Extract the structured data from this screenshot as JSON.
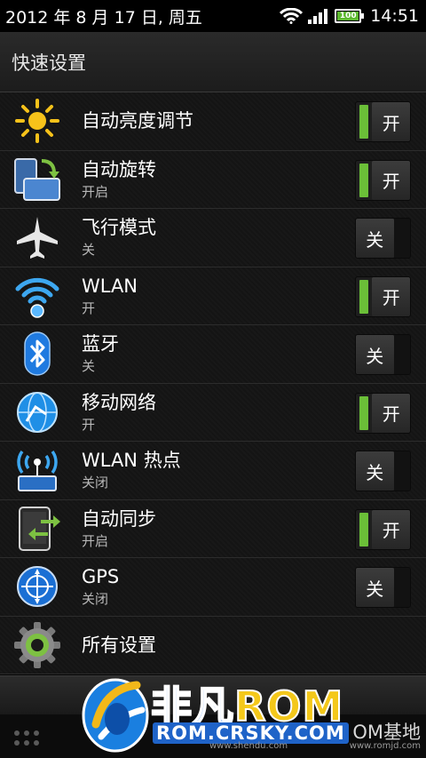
{
  "status_bar": {
    "date": "2012 年 8 月 17 日, 周五",
    "battery": "100",
    "time": "14:51"
  },
  "header": {
    "title": "快速设置"
  },
  "items": [
    {
      "icon": "brightness-icon",
      "label": "自动亮度调节",
      "sub": "",
      "toggle": "开",
      "state": "on"
    },
    {
      "icon": "rotate-icon",
      "label": "自动旋转",
      "sub": "开启",
      "toggle": "开",
      "state": "on"
    },
    {
      "icon": "airplane-icon",
      "label": "飞行模式",
      "sub": "关",
      "toggle": "关",
      "state": "off"
    },
    {
      "icon": "wifi-icon",
      "label": "WLAN",
      "sub": "开",
      "toggle": "开",
      "state": "on"
    },
    {
      "icon": "bluetooth-icon",
      "label": "蓝牙",
      "sub": "关",
      "toggle": "关",
      "state": "off"
    },
    {
      "icon": "globe-network-icon",
      "label": "移动网络",
      "sub": "开",
      "toggle": "开",
      "state": "on"
    },
    {
      "icon": "hotspot-icon",
      "label": "WLAN 热点",
      "sub": "关闭",
      "toggle": "关",
      "state": "off"
    },
    {
      "icon": "sync-icon",
      "label": "自动同步",
      "sub": "开启",
      "toggle": "开",
      "state": "on"
    },
    {
      "icon": "gps-icon",
      "label": "GPS",
      "sub": "关闭",
      "toggle": "关",
      "state": "off"
    },
    {
      "icon": "gear-icon",
      "label": "所有设置",
      "sub": "",
      "toggle": "",
      "state": ""
    }
  ],
  "watermark": {
    "brand_a": "非凡",
    "brand_b": "ROM",
    "url": "ROM.CRSKY.COM",
    "side_text": "OM基地",
    "small_url_left": "www.shendu.com",
    "small_url_right": "www.romjd.com"
  },
  "colors": {
    "toggle_on": "#6bbf38",
    "background": "#151515"
  }
}
